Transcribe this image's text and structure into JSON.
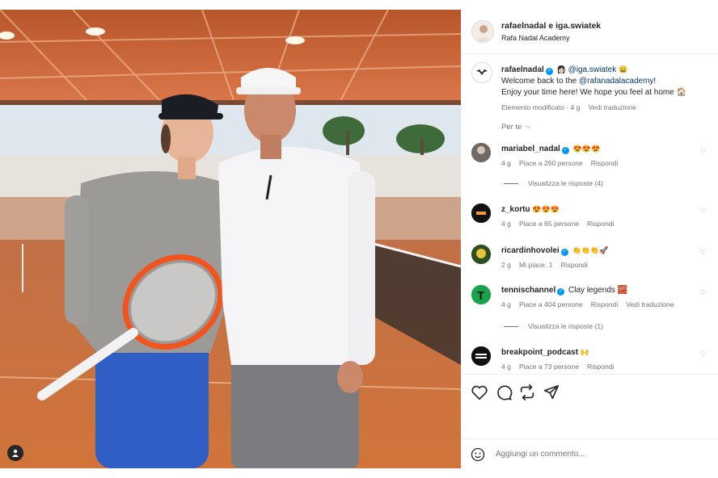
{
  "post": {
    "author": "rafaelnadal e iga.swiatek",
    "location": "Rafa Nadal Academy"
  },
  "caption": {
    "user": "rafaelnadal",
    "mention": "@iga.swiatek",
    "emojis": "😀",
    "line1_prefix": "Welcome back to the ",
    "line1_link": "@rafanadalacademy",
    "line1_suffix": "!",
    "line2": "Enjoy your time here! We hope you feel at home 🏠",
    "edited": "Elemento modificato",
    "time": "4 g",
    "translate": "Vedi traduzione"
  },
  "filter_label": "Per te",
  "comments": [
    {
      "user": "mariabel_nadal",
      "verified": true,
      "text": "😍😍😍",
      "time": "4 g",
      "likes": "Piace a 260 persone",
      "reply": "Rispondi",
      "replies": "Visualizza le risposte (4)"
    },
    {
      "user": "z_kortu",
      "verified": false,
      "text": "😍😍😍",
      "time": "4 g",
      "likes": "Piace a 65 persone",
      "reply": "Rispondi"
    },
    {
      "user": "ricardinhovolei",
      "verified": true,
      "text": "👏👏👏🚀",
      "time": "2 g",
      "likes": "Mi piace: 1",
      "reply": "Rispondi"
    },
    {
      "user": "tennischannel",
      "verified": true,
      "text": "Clay legends 🧱",
      "time": "4 g",
      "likes": "Piace a 404 persone",
      "reply": "Rispondi",
      "translate": "Vedi traduzione",
      "replies": "Visualizza le risposte (1)"
    },
    {
      "user": "breakpoint_podcast",
      "verified": false,
      "text": "🙌",
      "time": "4 g",
      "likes": "Piace a 73 persone",
      "reply": "Rispondi"
    }
  ],
  "add_comment_placeholder": "Aggiungi un commento...",
  "icons": [
    "like-heart-icon",
    "comment-icon",
    "share-icon",
    "send-icon",
    "emoji-icon",
    "tagged-user-icon"
  ],
  "colors": {
    "accent": "#0095f6",
    "clay": "#c9713f",
    "text": "#262626",
    "muted": "#737373"
  }
}
